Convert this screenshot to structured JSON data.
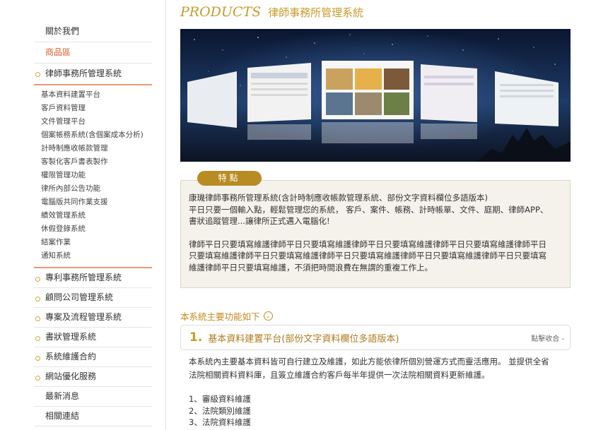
{
  "sidebar": {
    "top_items": [
      "關於我們",
      "商品區"
    ],
    "current": "律師事務所管理系統",
    "sub_items": [
      "基本資料建置平台",
      "客戶資料管理",
      "文件管理平台",
      "個案帳務系統(含個案成本分析)",
      "計時制應收帳款管理",
      "客製化客戶書表製作",
      "權限管理功能",
      "律所內部公告功能",
      "電腦版共同作業支援",
      "績效管理系統",
      "休假登錄系統",
      "結案作業",
      "通知系統"
    ],
    "other_items": [
      "專利事務所管理系統",
      "顧問公司管理系統",
      "專案及流程管理系統",
      "書狀管理系統",
      "系統維護合約",
      "網站優化服務"
    ],
    "bottom_items": [
      "最新消息",
      "相關連結"
    ]
  },
  "header": {
    "title_en": "PRODUCTS",
    "title_zh": "律師事務所管理系統"
  },
  "features": {
    "tab_label": "特點",
    "lines": [
      "康璣律師事務所管理系統(含計時制應收帳款管理系統、部份文字資料欄位多語版本)",
      "平日只要一個輸入點，輕鬆管理您的系統， 客戶、案件、帳務、計時帳單、文件、庭期、律師APP、",
      "書狀追蹤管理...讓律所正式邁入電腦化!"
    ],
    "lines2": [
      "律師平日只要填寫維護律師平日只要填寫維護律師平日只要填寫維護律師平日只要填寫維護律師平日",
      "只要填寫維護律師平日只要填寫維護律師平日只要填寫維護律師平日只要填寫維護律師平日只要填寫",
      "維護律師平日只要填寫維護，不須把時間浪費在無謂的重複工作上。"
    ]
  },
  "main_functions": {
    "heading": "本系統主要功能如下",
    "icon": "chevron-down-circle-icon"
  },
  "accordion": {
    "number": "1.",
    "title": "基本資料建置平台(部份文字資料欄位多語版本)",
    "toggle": "點擊收合 -"
  },
  "body": {
    "lines": [
      "本系統內主要基本資料皆可自行建立及維護，如此方能依律所個別營運方式而靈活應用。 並提供全省",
      "法院相關資料資料庫，且簽立維護合約客戶每半年提供一次法院相關資料更新維護。"
    ],
    "list": [
      "1、審級資料維護",
      "2、法院類別維護",
      "3、法院資料維護"
    ]
  },
  "colors": {
    "accent": "#c79a2b",
    "active": "#e2582b",
    "tab": "#b78c23",
    "divider": "#e99a7b"
  }
}
